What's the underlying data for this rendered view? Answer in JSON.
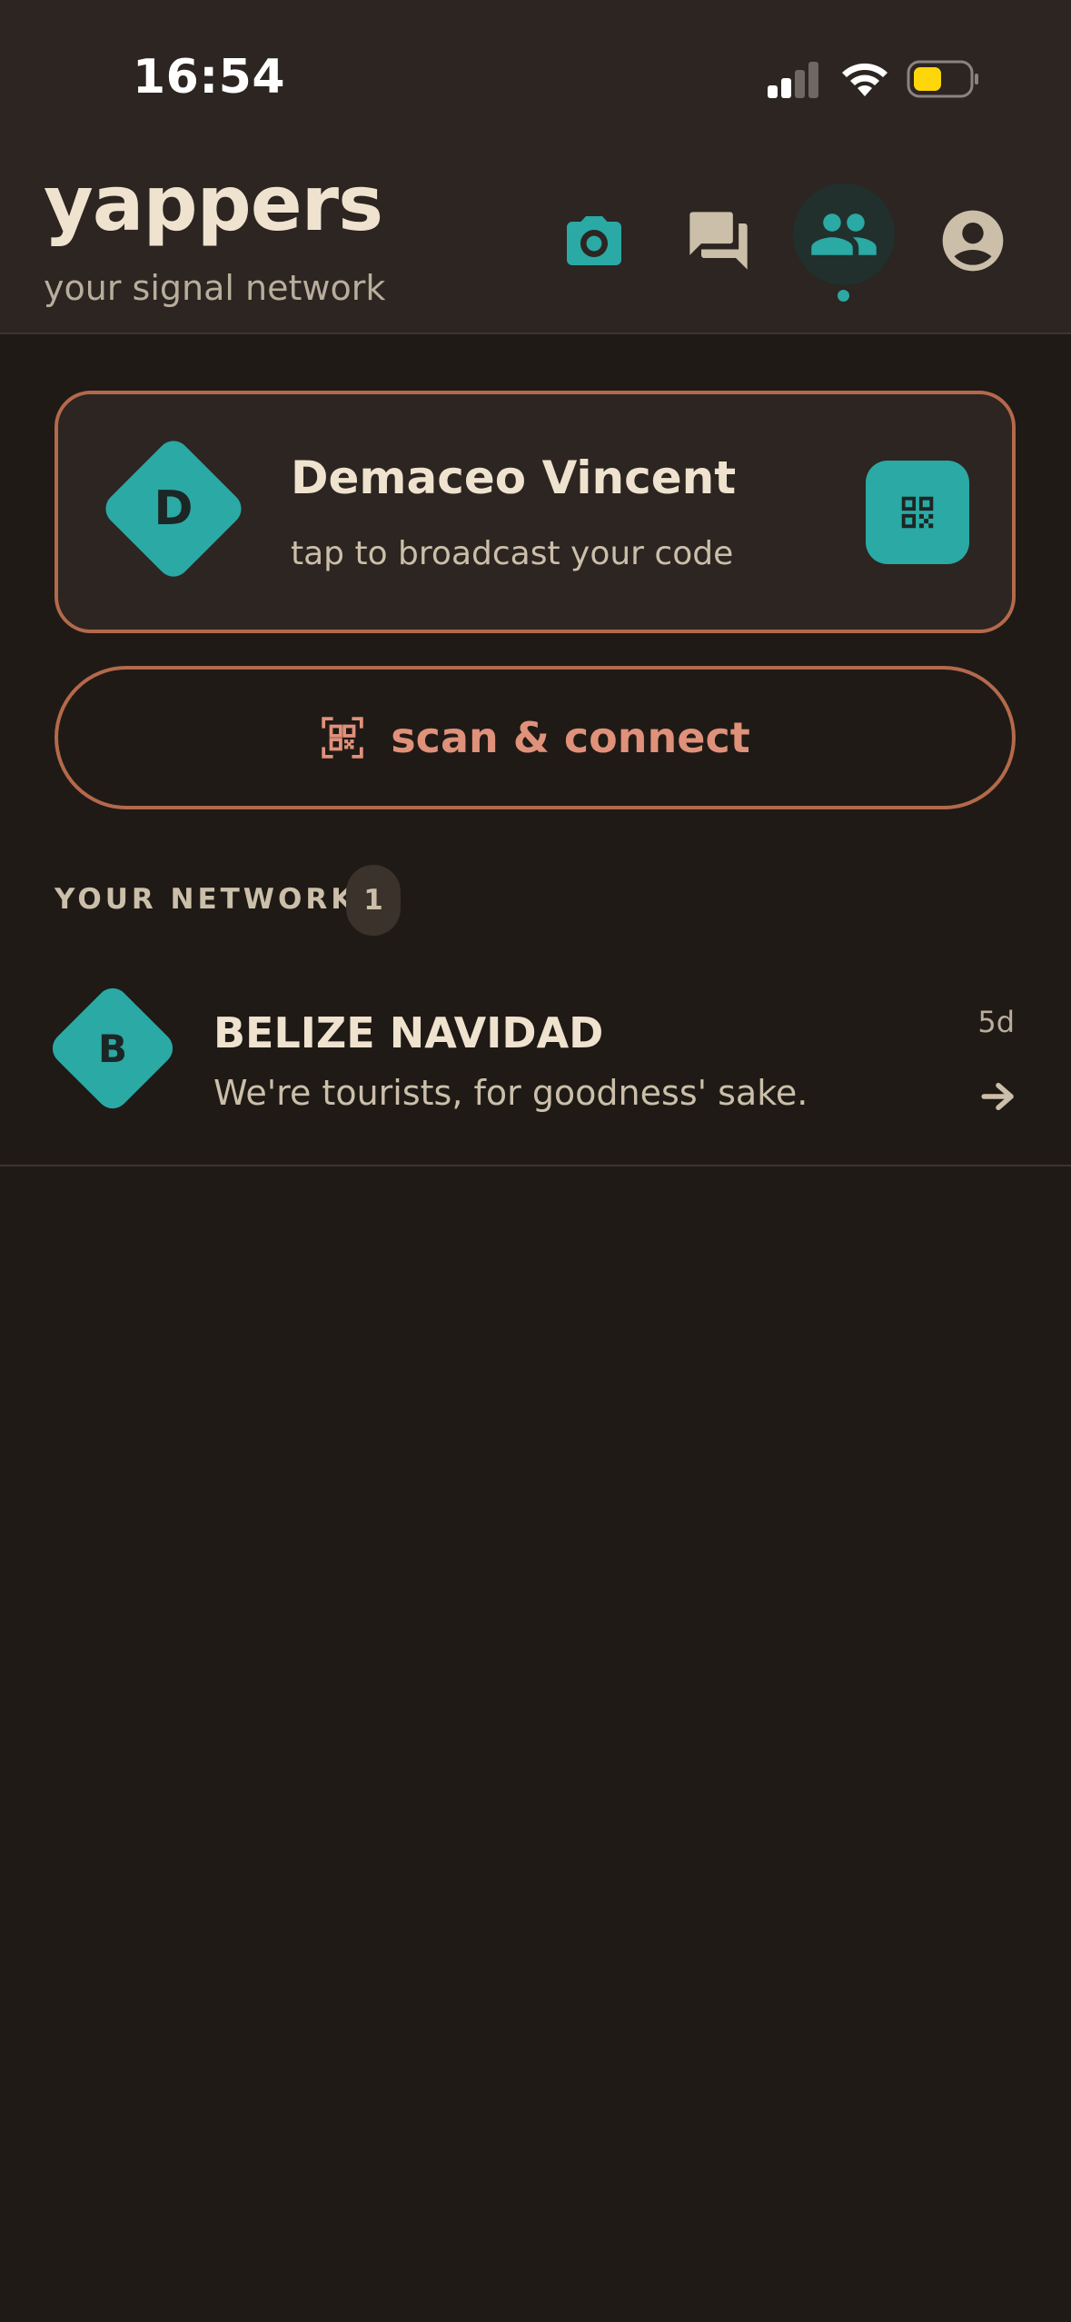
{
  "status_bar": {
    "time": "16:54"
  },
  "header": {
    "app_title": "yappers",
    "subtitle": "your signal network",
    "nav_icons": [
      "camera-icon",
      "chat-icon",
      "people-icon",
      "account-icon"
    ],
    "active_nav": "people-icon"
  },
  "profile_card": {
    "avatar_letter": "D",
    "name": "Demaceo Vincent",
    "hint": "tap to broadcast your code",
    "action_icon": "qr-code-icon"
  },
  "scan_button": {
    "label": "scan & connect",
    "icon": "qr-scan-icon"
  },
  "network": {
    "section_label": "YOUR NETWORK",
    "count": "1",
    "contacts": [
      {
        "avatar_letter": "B",
        "name": "BELIZE NAVIDAD",
        "status": "We're tourists, for goodness' sake.",
        "time": "5d",
        "action_icon": "arrow-right-icon"
      }
    ]
  },
  "colors": {
    "background": "#1f1a16",
    "header_background": "#2c2521",
    "accent_teal": "#2aa9a5",
    "accent_copper": "#b4694b",
    "accent_text": "#e0917a",
    "text_primary": "#efe3cf",
    "text_secondary": "#cbbfa9",
    "battery_fill": "#ffd60a"
  }
}
